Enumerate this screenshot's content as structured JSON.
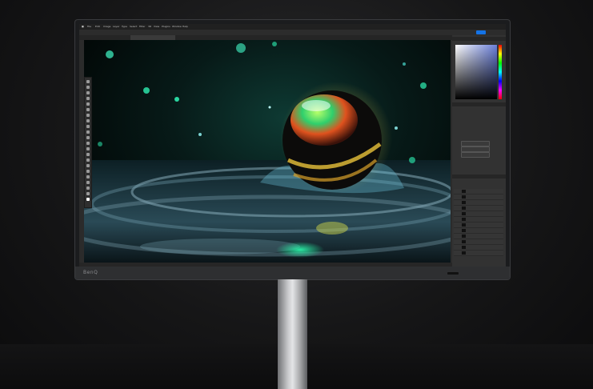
{
  "scene": {
    "description_type": "product photo of monitor showing image editor",
    "colors": {
      "accent_blue": "#1473e6",
      "backdrop": "#161617",
      "stand": "#c9cacc"
    }
  },
  "monitor": {
    "brand": "BenQ"
  },
  "editor": {
    "menu": [
      "File",
      "Edit",
      "Image",
      "Layer",
      "Type",
      "Select",
      "Filter",
      "3D",
      "View",
      "Plugins",
      "Window",
      "Help"
    ],
    "tabs": [
      "",
      ""
    ],
    "status": ""
  }
}
